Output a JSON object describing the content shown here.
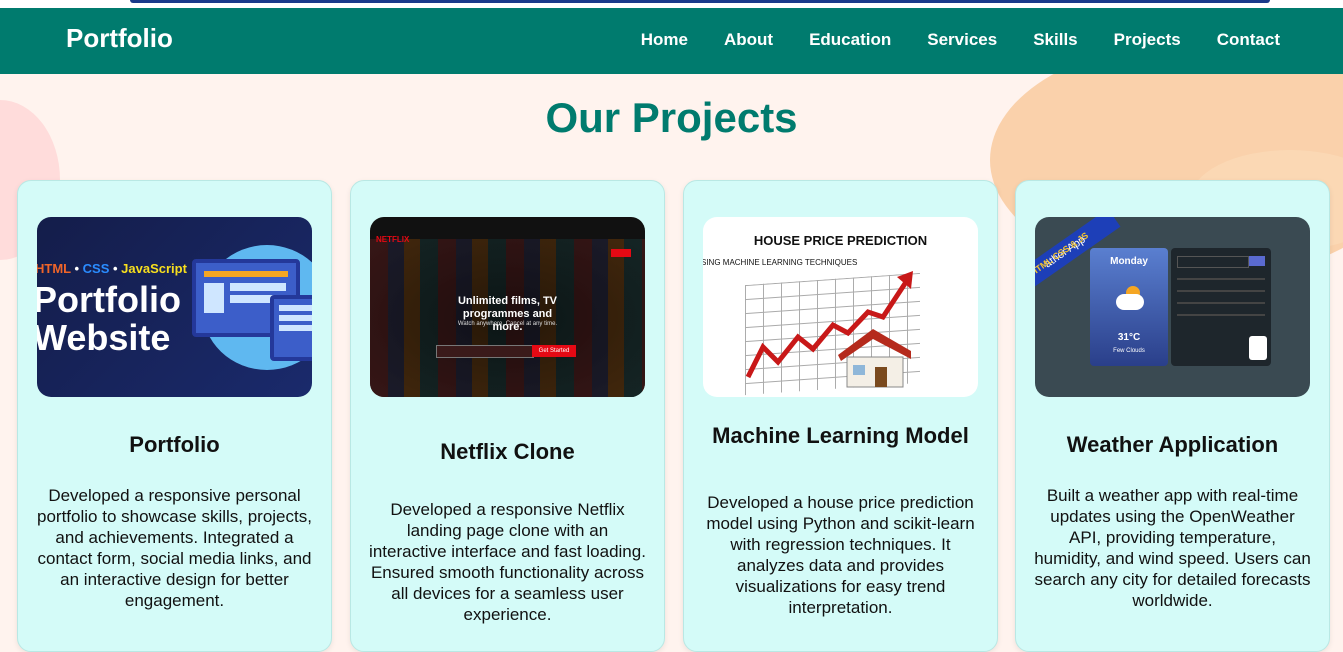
{
  "navbar": {
    "brand": "Portfolio",
    "links": [
      "Home",
      "About",
      "Education",
      "Services",
      "Skills",
      "Projects",
      "Contact"
    ]
  },
  "section_title": "Our Projects",
  "projects": [
    {
      "title": "Portfolio",
      "description": "Developed a responsive personal portfolio to showcase skills, projects, and achievements. Integrated a contact form, social media links, and an interactive design for better engagement.",
      "thumb": {
        "tags": [
          "HTML",
          "CSS",
          "JavaScript"
        ],
        "tag_colors": [
          "#f06529",
          "#2965f1",
          "#f7df1e"
        ],
        "line1": "Portfolio",
        "line2": "Website"
      }
    },
    {
      "title": "Netflix Clone",
      "description": "Developed a responsive Netflix landing page clone with an interactive interface and fast loading. Ensured smooth functionality across all devices for a seamless user experience.",
      "thumb": {
        "logo": "NETFLIX",
        "headline": "Unlimited films, TV programmes and more.",
        "sub": "Watch anywhere. Cancel at any time.",
        "button": "Get Started"
      }
    },
    {
      "title": "Machine Learning Model",
      "description": "Developed a house price prediction model using Python and scikit-learn with regression techniques. It analyzes data and provides visualizations for easy trend interpretation.",
      "thumb": {
        "heading": "HOUSE PRICE PREDICTION",
        "sub": "SING MACHINE LEARNING TECHNIQUES"
      }
    },
    {
      "title": "Weather Application",
      "description": "Built a weather app with real-time updates using the OpenWeather API, providing temperature, humidity, and wind speed. Users can search any city for detailed forecasts worldwide.",
      "thumb": {
        "ribbon": "ather App",
        "ribbon_sub": "HTML CSS & JS",
        "day": "Monday",
        "temp": "31°C",
        "condition": "Few Clouds"
      }
    }
  ],
  "colors": {
    "primary": "#007b6e",
    "card_bg": "#d4fbf8",
    "netflix_red": "#e50914"
  }
}
